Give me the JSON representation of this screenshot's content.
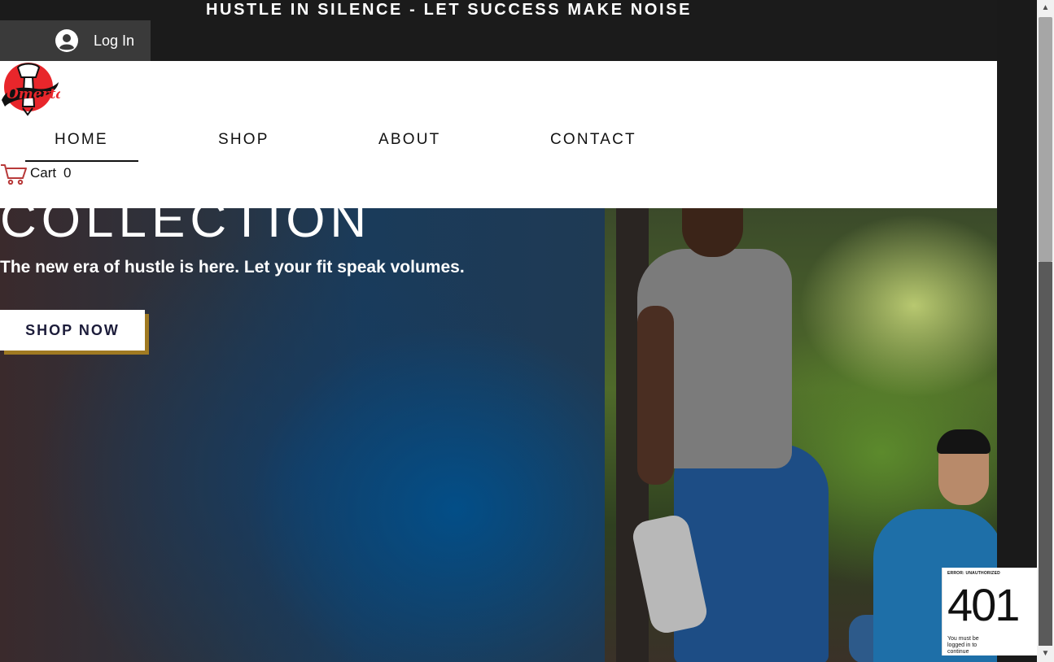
{
  "announcement": "HUSTLE IN SILENCE - LET SUCCESS MAKE NOISE",
  "login": {
    "label": "Log In",
    "icon": "user-avatar-icon"
  },
  "brand": {
    "logo_text": "Omerta",
    "logo_colors": {
      "red": "#e8262b",
      "black": "#111111"
    }
  },
  "nav": {
    "items": [
      {
        "label": "HOME"
      },
      {
        "label": "SHOP"
      },
      {
        "label": "ABOUT"
      },
      {
        "label": "CONTACT"
      }
    ],
    "active": "HOME"
  },
  "cart": {
    "label": "Cart",
    "count": "0",
    "icon": "cart-icon",
    "icon_color": "#b83a3a"
  },
  "hero": {
    "heading": "COLLECTION",
    "subtitle": "The new era of hustle is here. Let your fit speak volumes.",
    "cta_label": "SHOP NOW",
    "cta_shadow_color": "#a07a22"
  },
  "error_widget": {
    "title": "ERROR: UNAUTHORIZED",
    "code": "401",
    "message": "You must be logged in to continue"
  },
  "colors": {
    "topbar": "#1b1b1b",
    "header_bg": "#ffffff",
    "text_dark": "#111111",
    "cta_text": "#1c1c3a"
  }
}
